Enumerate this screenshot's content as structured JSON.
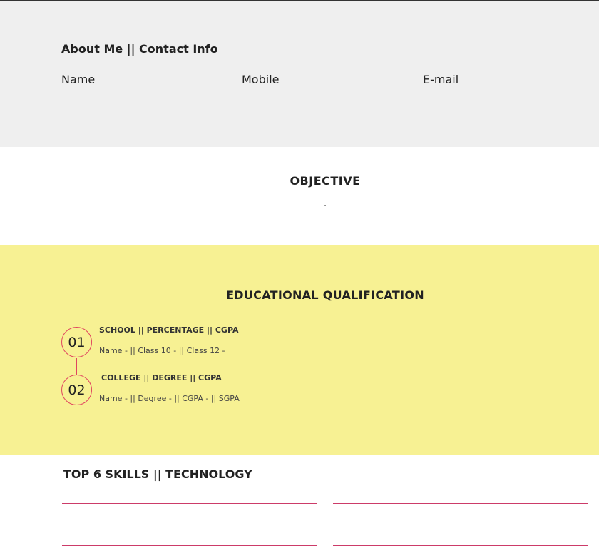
{
  "about": {
    "title": "About Me || Contact Info",
    "name_label": "Name",
    "mobile_label": "Mobile",
    "email_label": "E-mail"
  },
  "objective": {
    "title": "OBJECTIVE",
    "text": "."
  },
  "education": {
    "title": "EDUCATIONAL QUALIFICATION",
    "items": [
      {
        "number": "01",
        "heading": "SCHOOL || PERCENTAGE || CGPA",
        "detail": "Name - || Class 10 - || Class 12 -"
      },
      {
        "number": "02",
        "heading": "COLLEGE || DEGREE || CGPA",
        "detail": "Name - || Degree - || CGPA - || SGPA"
      }
    ]
  },
  "skills": {
    "title": "TOP 6 SKILLS || TECHNOLOGY"
  },
  "colors": {
    "about_bg": "#efefef",
    "education_bg": "#f7f193",
    "accent": "#e0455f",
    "skill_line": "#cc3b69"
  }
}
